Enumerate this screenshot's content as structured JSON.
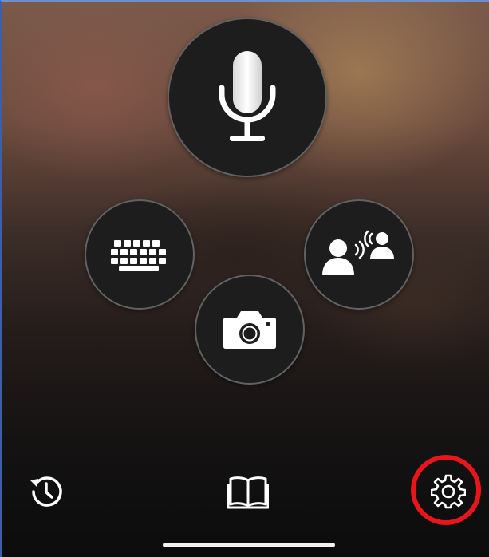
{
  "main_actions": [
    {
      "id": "microphone",
      "icon": "microphone-icon"
    },
    {
      "id": "keyboard",
      "icon": "keyboard-icon"
    },
    {
      "id": "conversation",
      "icon": "conversation-icon"
    },
    {
      "id": "camera",
      "icon": "camera-icon"
    }
  ],
  "bottom_bar": {
    "history_icon": "history-icon",
    "phrasebook_icon": "book-icon",
    "settings_icon": "gear-icon"
  },
  "highlight": {
    "target": "settings",
    "color": "#e8161b"
  },
  "colors": {
    "button_fill": "#1d1d1d",
    "button_border": "#6e6e6e",
    "icon": "#ffffff",
    "highlight": "#e8161b"
  }
}
